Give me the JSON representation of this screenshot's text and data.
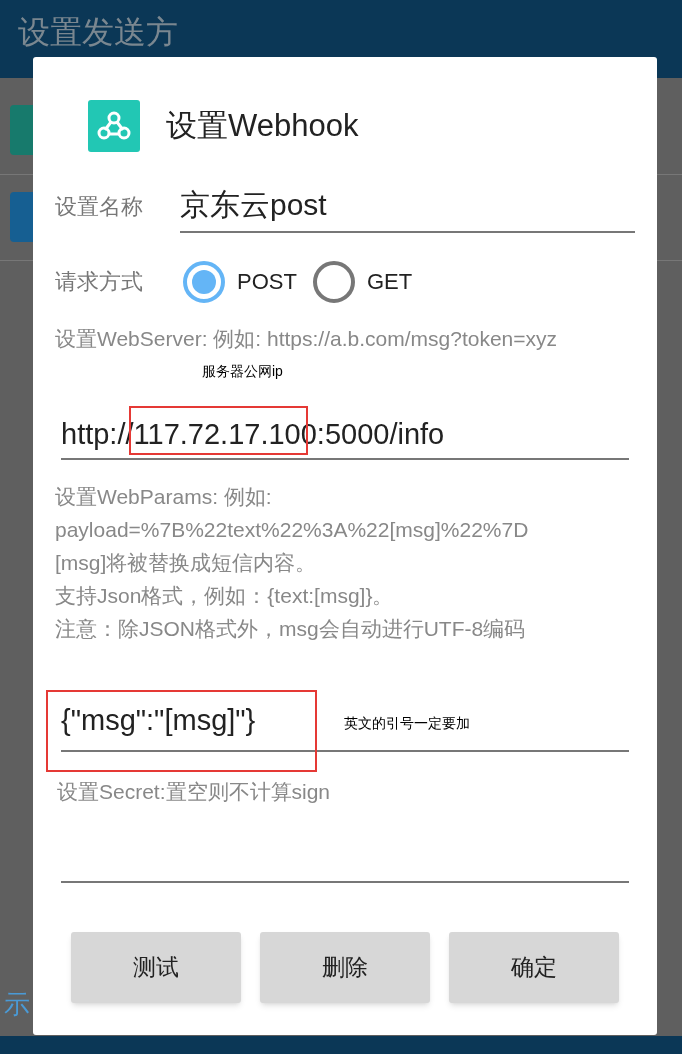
{
  "app_bar": {
    "title": "设置发送方"
  },
  "background": {
    "footer_left": "示"
  },
  "dialog": {
    "title": "设置Webhook",
    "name_field": {
      "label": "设置名称",
      "value": "京东云post"
    },
    "method": {
      "label": "请求方式",
      "options": [
        {
          "label": "POST",
          "selected": true
        },
        {
          "label": "GET",
          "selected": false
        }
      ]
    },
    "server_hint": "设置WebServer: 例如: https://a.b.com/msg?token=xyz",
    "server_field": {
      "value": "http://117.72.17.100:5000/info"
    },
    "params_hint": [
      "设置WebParams: 例如:",
      "payload=%7B%22text%22%3A%22[msg]%22%7D",
      "[msg]将被替换成短信内容。",
      "支持Json格式，例如：{text:[msg]}。",
      "注意：除JSON格式外，msg会自动进行UTF-8编码"
    ],
    "params_field": {
      "value": "{\"msg\":\"[msg]\"}"
    },
    "secret_field": {
      "placeholder": "设置Secret:置空则不计算sign"
    },
    "buttons": [
      "测试",
      "删除",
      "确定"
    ]
  },
  "annotations": [
    "服务器公网ip",
    "英文的引号一定要加"
  ]
}
